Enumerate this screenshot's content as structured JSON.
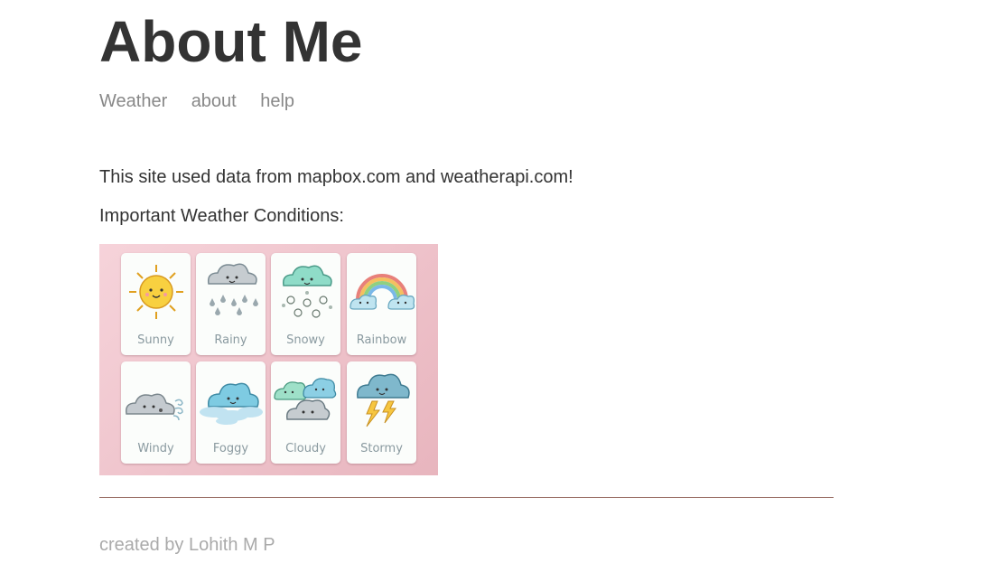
{
  "header": {
    "title": "About Me"
  },
  "nav": {
    "items": [
      "Weather",
      "about",
      "help"
    ]
  },
  "main": {
    "intro": "This site used data from mapbox.com and weatherapi.com!",
    "conditions_heading": "Important Weather Conditions:",
    "image_cards": [
      {
        "label": "Sunny",
        "icon": "sun-icon"
      },
      {
        "label": "Rainy",
        "icon": "rain-cloud-icon"
      },
      {
        "label": "Snowy",
        "icon": "snow-cloud-icon"
      },
      {
        "label": "Rainbow",
        "icon": "rainbow-icon"
      },
      {
        "label": "Windy",
        "icon": "wind-cloud-icon"
      },
      {
        "label": "Foggy",
        "icon": "fog-cloud-icon"
      },
      {
        "label": "Cloudy",
        "icon": "clouds-icon"
      },
      {
        "label": "Stormy",
        "icon": "storm-cloud-icon"
      }
    ]
  },
  "footer": {
    "text": "created by Lohith M P"
  },
  "colors": {
    "nav": "#888888",
    "footer": "#aaaaaa",
    "rule": "#9a6f66",
    "image_background": "#f2c9d1"
  }
}
